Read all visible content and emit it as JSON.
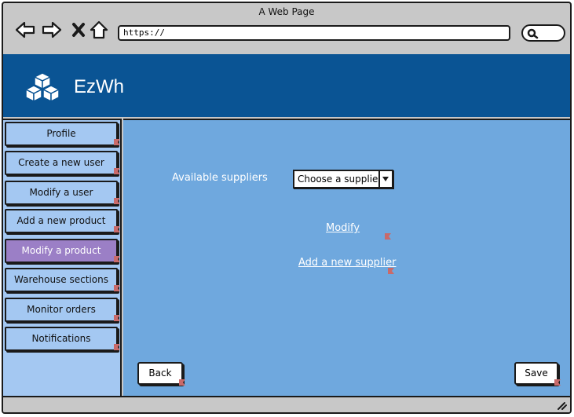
{
  "browser": {
    "window_title": "A Web Page",
    "url": "https://",
    "nav_icons": [
      "back-arrow-icon",
      "forward-arrow-icon",
      "close-x-icon",
      "home-icon"
    ],
    "search_icon": "search-icon"
  },
  "header": {
    "app_name": "EzWh",
    "logo_icon": "boxes-icon",
    "background_color": "#0a5494"
  },
  "sidebar": {
    "items": [
      {
        "label": "Profile",
        "active": false
      },
      {
        "label": "Create a new user",
        "active": false
      },
      {
        "label": "Modify a user",
        "active": false
      },
      {
        "label": "Add a new product",
        "active": false
      },
      {
        "label": "Modify a product",
        "active": true
      },
      {
        "label": "Warehouse sections",
        "active": false
      },
      {
        "label": "Monitor orders",
        "active": false
      },
      {
        "label": "Notifications",
        "active": false
      }
    ],
    "item_color": "#a4c8f2",
    "active_color": "#9b7fc6"
  },
  "main": {
    "supplier_label": "Available suppliers",
    "supplier_select_value": "Choose a supplier",
    "modify_link": "Modify",
    "add_supplier_link": "Add a new supplier",
    "back_button": "Back",
    "save_button": "Save",
    "background_color": "#6fa8de"
  }
}
